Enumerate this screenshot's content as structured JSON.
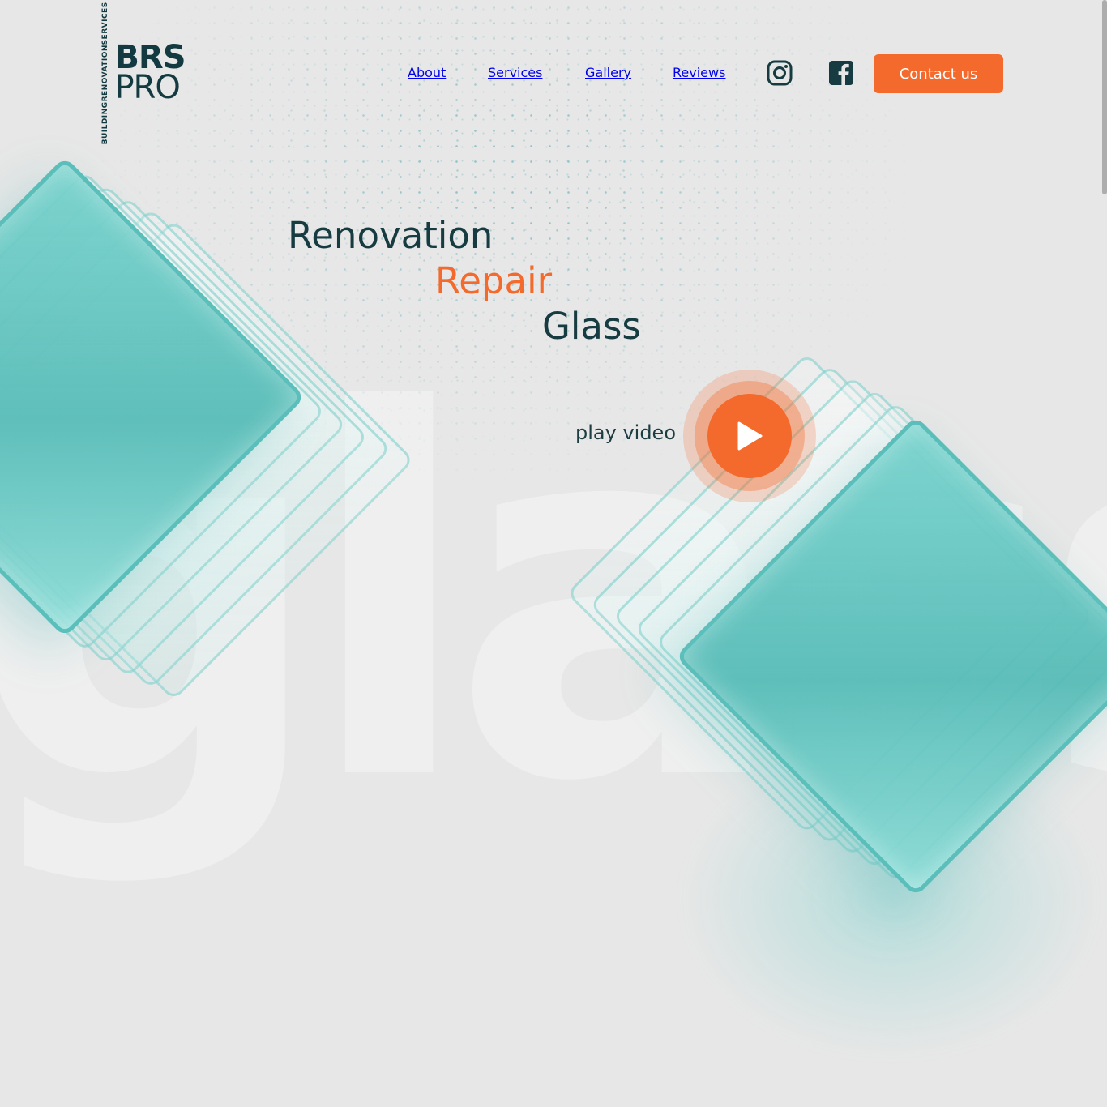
{
  "brand": {
    "vertical_lines": [
      "BUILDING",
      "RENOVATION",
      "SERVICES"
    ],
    "name_top": "BRS",
    "name_bottom": "PRO"
  },
  "nav": {
    "items": [
      {
        "label": "About"
      },
      {
        "label": "Services"
      },
      {
        "label": "Gallery"
      },
      {
        "label": "Reviews"
      }
    ],
    "social": [
      {
        "icon": "instagram-icon"
      },
      {
        "icon": "facebook-icon"
      }
    ],
    "contact_label": "Contact us"
  },
  "hero": {
    "lines": [
      "Renovation",
      "Repair",
      "Glass"
    ],
    "play_label": "play video",
    "background_word": "glass"
  },
  "colors": {
    "accent": "#f46a2c",
    "text_dark": "#163b41",
    "background": "#e7e7e7",
    "glass_teal": "#5cc0bb"
  }
}
